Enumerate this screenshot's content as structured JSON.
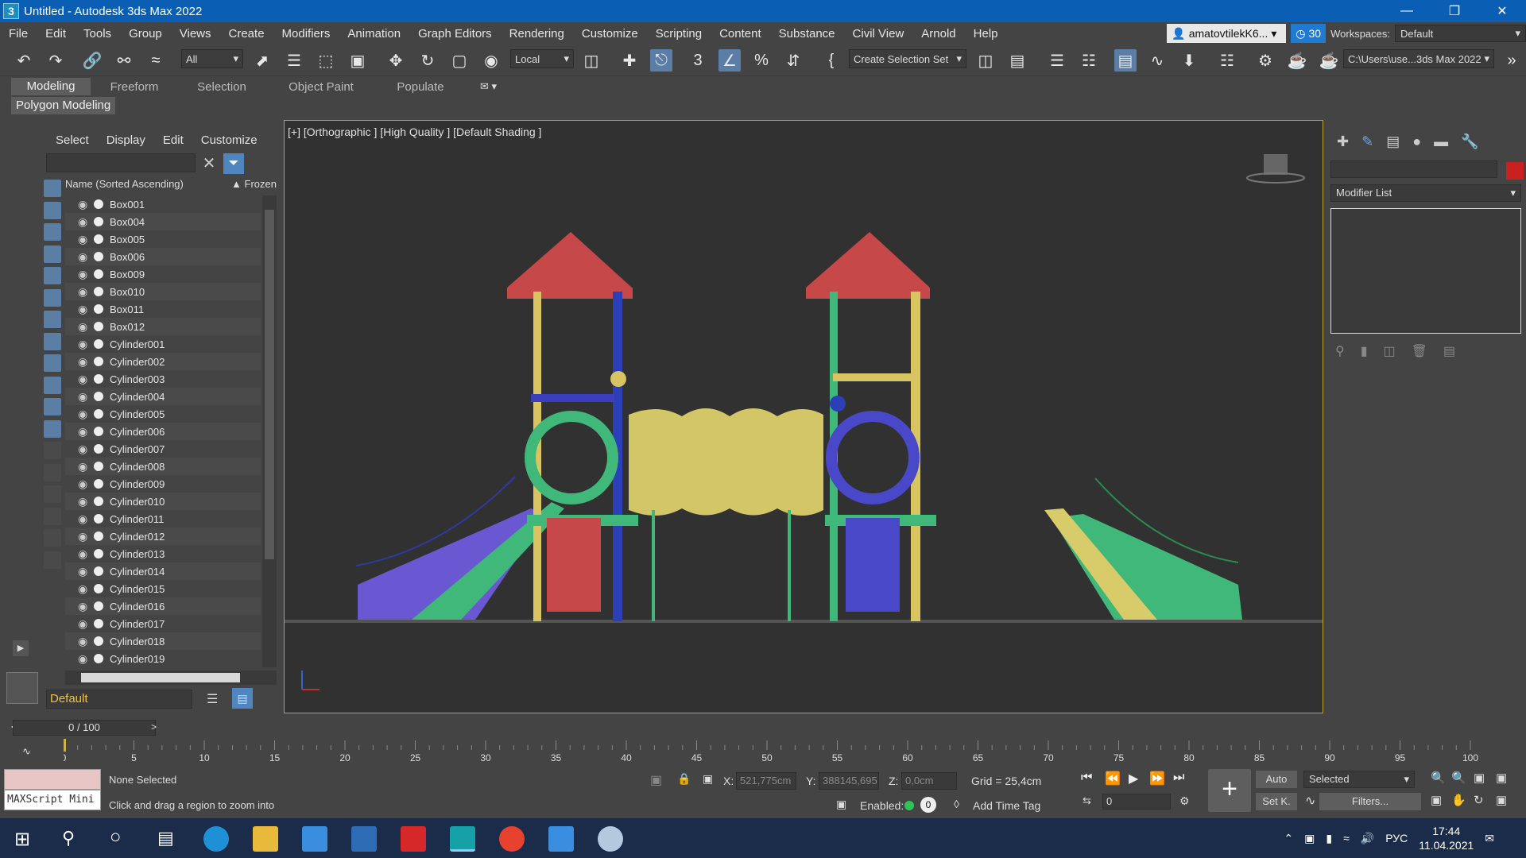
{
  "window": {
    "title": "Untitled - Autodesk 3ds Max 2022",
    "app_icon": "3"
  },
  "menu": [
    "File",
    "Edit",
    "Tools",
    "Group",
    "Views",
    "Create",
    "Modifiers",
    "Animation",
    "Graph Editors",
    "Rendering",
    "Customize",
    "Scripting",
    "Content",
    "Substance",
    "Civil View",
    "Arnold",
    "Help"
  ],
  "account": {
    "user": "amatovtilekK6...",
    "clock_count": "30",
    "workspaces_label": "Workspaces:",
    "workspace": "Default"
  },
  "toolbar": {
    "filter": "All",
    "coord_system": "Local",
    "selection_set": "Create Selection Set",
    "project_path": "C:\\Users\\use...3ds Max 2022"
  },
  "ribbon": {
    "tabs": [
      "Modeling",
      "Freeform",
      "Selection",
      "Object Paint",
      "Populate"
    ],
    "active_tab": "Modeling",
    "subtab": "Polygon Modeling"
  },
  "scene_explorer": {
    "tabs": [
      "Select",
      "Display",
      "Edit",
      "Customize"
    ],
    "column_name": "Name (Sorted Ascending)",
    "column_frozen": "Frozen",
    "items": [
      "Box001",
      "Box004",
      "Box005",
      "Box006",
      "Box009",
      "Box010",
      "Box011",
      "Box012",
      "Cylinder001",
      "Cylinder002",
      "Cylinder003",
      "Cylinder004",
      "Cylinder005",
      "Cylinder006",
      "Cylinder007",
      "Cylinder008",
      "Cylinder009",
      "Cylinder010",
      "Cylinder011",
      "Cylinder012",
      "Cylinder013",
      "Cylinder014",
      "Cylinder015",
      "Cylinder016",
      "Cylinder017",
      "Cylinder018",
      "Cylinder019"
    ],
    "layer": "Default"
  },
  "viewport": {
    "label": "[+] [Orthographic ] [High Quality ] [Default Shading ]"
  },
  "command_panel": {
    "modifier_list": "Modifier List",
    "object_color": "#c92020"
  },
  "timeline": {
    "frame_display": "0 / 100",
    "ticks": [
      "0",
      "5",
      "10",
      "15",
      "20",
      "25",
      "30",
      "35",
      "40",
      "45",
      "50",
      "55",
      "60",
      "65",
      "70",
      "75",
      "80",
      "85",
      "90",
      "95",
      "100"
    ]
  },
  "status": {
    "maxscript": "MAXScript Mini",
    "selection": "None Selected",
    "prompt": "Click and drag a region to zoom into",
    "x_label": "X:",
    "x_value": "521,775cm",
    "y_label": "Y:",
    "y_value": "388145,695",
    "z_label": "Z:",
    "z_value": "0,0cm",
    "grid": "Grid = 25,4cm",
    "enabled_label": "Enabled:",
    "enabled_value": "0",
    "add_time_tag": "Add Time Tag",
    "frame": "0",
    "auto": "Auto",
    "setkey": "Set K.",
    "selected": "Selected",
    "filters": "Filters..."
  },
  "taskbar": {
    "lang": "РУС",
    "time": "17:44",
    "date": "11.04.2021"
  }
}
